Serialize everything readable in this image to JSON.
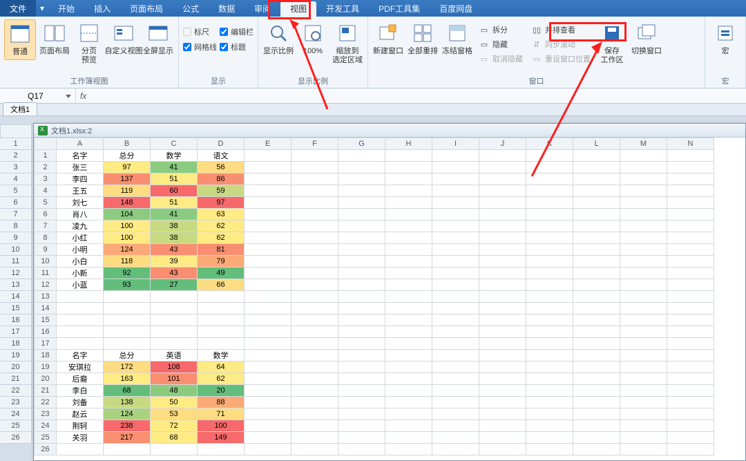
{
  "menu": {
    "file": "文件",
    "tabs": [
      "开始",
      "插入",
      "页面布局",
      "公式",
      "数据",
      "审阅",
      "视图",
      "开发工具",
      "PDF工具集",
      "百度网盘"
    ],
    "activeIndex": 6
  },
  "ribbon": {
    "views": {
      "normal": "普通",
      "pageLayout": "页面布局",
      "pageBreak": "分页\n预览",
      "custom": "自定义视图",
      "full": "全屏显示",
      "group": "工作簿视图"
    },
    "show": {
      "ruler": "标尺",
      "formula": "编辑栏",
      "grid": "网格线",
      "heading": "标题",
      "group": "显示"
    },
    "zoom": {
      "ratio": "显示比例",
      "hundred": "100%",
      "fit": "缩放到\n选定区域",
      "group": "显示比例"
    },
    "window": {
      "newwin": "新建窗口",
      "arrange": "全部重排",
      "freeze": "冻结窗格",
      "split": "拆分",
      "hide": "隐藏",
      "unhide": "取消隐藏",
      "sidebyside": "并排查看",
      "sync": "同步滚动",
      "reset": "重设窗口位置",
      "save": "保存\n工作区",
      "switch": "切换窗口",
      "group": "窗口"
    },
    "macro": {
      "label": "宏"
    }
  },
  "namebox": "Q17",
  "doctab": "文档1",
  "childTitle": "文档1.xlsx:2",
  "cols": [
    "A",
    "B",
    "C",
    "D",
    "E",
    "F",
    "G",
    "H",
    "I",
    "J",
    "K",
    "L",
    "M",
    "N"
  ],
  "outerRows": [
    1,
    2,
    3,
    4,
    5,
    6,
    7,
    8,
    9,
    10,
    11,
    12,
    13,
    14,
    15,
    16,
    17,
    18,
    19,
    20,
    21,
    22,
    23,
    24,
    25,
    26
  ],
  "table1": {
    "startRow": 1,
    "header": [
      "名字",
      "总分",
      "数学",
      "语文"
    ],
    "rows": [
      {
        "r": 2,
        "c": [
          "张三",
          "97",
          "41",
          "56"
        ],
        "cls": [
          "",
          "y1",
          "g2",
          "y2"
        ]
      },
      {
        "r": 3,
        "c": [
          "李四",
          "137",
          "51",
          "86"
        ],
        "cls": [
          "",
          "o2",
          "y1",
          "o2"
        ]
      },
      {
        "r": 4,
        "c": [
          "王五",
          "119",
          "60",
          "59"
        ],
        "cls": [
          "",
          "y2",
          "r1",
          "g4"
        ]
      },
      {
        "r": 5,
        "c": [
          "刘七",
          "148",
          "51",
          "97"
        ],
        "cls": [
          "",
          "r1",
          "y1",
          "r1"
        ]
      },
      {
        "r": 6,
        "c": [
          "肖八",
          "104",
          "41",
          "63"
        ],
        "cls": [
          "",
          "g2",
          "g2",
          "y1"
        ]
      },
      {
        "r": 7,
        "c": [
          "凌九",
          "100",
          "38",
          "62"
        ],
        "cls": [
          "",
          "y1",
          "g4",
          "y1"
        ]
      },
      {
        "r": 8,
        "c": [
          "小红",
          "100",
          "38",
          "62"
        ],
        "cls": [
          "",
          "y1",
          "g4",
          "y1"
        ]
      },
      {
        "r": 9,
        "c": [
          "小明",
          "124",
          "43",
          "81"
        ],
        "cls": [
          "",
          "o1",
          "o2",
          "o2"
        ]
      },
      {
        "r": 10,
        "c": [
          "小白",
          "118",
          "39",
          "79"
        ],
        "cls": [
          "",
          "y2",
          "y1",
          "o1"
        ]
      },
      {
        "r": 11,
        "c": [
          "小新",
          "92",
          "43",
          "49"
        ],
        "cls": [
          "",
          "g1",
          "o2",
          "g1"
        ]
      },
      {
        "r": 12,
        "c": [
          "小蓝",
          "93",
          "27",
          "66"
        ],
        "cls": [
          "",
          "g1",
          "g1",
          "y2"
        ]
      }
    ]
  },
  "table2": {
    "startRow": 18,
    "header": [
      "名字",
      "总分",
      "英语",
      "数学"
    ],
    "rows": [
      {
        "r": 19,
        "c": [
          "安琪拉",
          "172",
          "108",
          "64"
        ],
        "cls": [
          "",
          "y2",
          "r1",
          "y1"
        ]
      },
      {
        "r": 20,
        "c": [
          "后裔",
          "163",
          "101",
          "62"
        ],
        "cls": [
          "",
          "y1",
          "o2",
          "y1"
        ]
      },
      {
        "r": 21,
        "c": [
          "李白",
          "68",
          "48",
          "20"
        ],
        "cls": [
          "",
          "g1",
          "g2",
          "g1"
        ]
      },
      {
        "r": 22,
        "c": [
          "刘备",
          "138",
          "50",
          "88"
        ],
        "cls": [
          "",
          "g4",
          "y1",
          "o1"
        ]
      },
      {
        "r": 23,
        "c": [
          "赵云",
          "124",
          "53",
          "71"
        ],
        "cls": [
          "",
          "g3",
          "y2",
          "y2"
        ]
      },
      {
        "r": 24,
        "c": [
          "荆轲",
          "238",
          "72",
          "100"
        ],
        "cls": [
          "",
          "r1",
          "y1",
          "r1"
        ]
      },
      {
        "r": 25,
        "c": [
          "关羽",
          "217",
          "68",
          "149"
        ],
        "cls": [
          "",
          "o2",
          "y1",
          "r1"
        ]
      }
    ]
  }
}
